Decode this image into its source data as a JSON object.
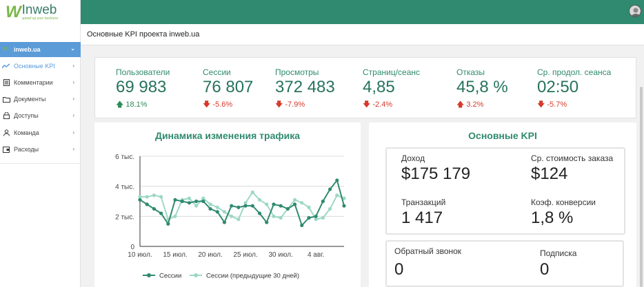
{
  "brand": {
    "logo_mark": "W",
    "name": "Inweb",
    "tagline": "speed up your business"
  },
  "sidebar": {
    "project": "inweb.ua",
    "items": [
      {
        "label": "Основные KPI",
        "icon": "trend-icon",
        "active": true
      },
      {
        "label": "Комментарии",
        "icon": "document-list-icon"
      },
      {
        "label": "Документы",
        "icon": "folder-icon"
      },
      {
        "label": "Доступы",
        "icon": "lock-icon"
      },
      {
        "label": "Команда",
        "icon": "user-icon"
      },
      {
        "label": "Расходы",
        "icon": "wallet-icon"
      }
    ]
  },
  "header": {
    "page_title": "Основные KPI проекта inweb.ua"
  },
  "kpis": [
    {
      "label": "Пользователи",
      "value": "69 983",
      "delta": "18.1%",
      "direction": "up",
      "color": "#2e8b57"
    },
    {
      "label": "Сессии",
      "value": "76 807",
      "delta": "-5.6%",
      "direction": "down",
      "color": "#d53a2b"
    },
    {
      "label": "Просмотры",
      "value": "372 483",
      "delta": "-7.9%",
      "direction": "down",
      "color": "#d53a2b"
    },
    {
      "label": "Страниц/сеанс",
      "value": "4,85",
      "delta": "-2.4%",
      "direction": "down",
      "color": "#d53a2b"
    },
    {
      "label": "Отказы",
      "value": "45,8 %",
      "delta": "3.2%",
      "direction": "up",
      "color": "#d53a2b"
    },
    {
      "label": "Ср. продол. сеанса",
      "value": "02:50",
      "delta": "-5.7%",
      "direction": "down",
      "color": "#d53a2b"
    }
  ],
  "traffic": {
    "title": "Динамика изменения трафика",
    "legend": [
      "Сессии",
      "Сессии (предыдущие 30 дней)"
    ]
  },
  "chart_data": {
    "type": "line",
    "title": "Динамика изменения трафика",
    "y_tick_labels": [
      "0",
      "2 тыс.",
      "4 тыс.",
      "6 тыс."
    ],
    "y_ticks": [
      0,
      2000,
      4000,
      6000
    ],
    "ylim": [
      0,
      6000
    ],
    "x_tick_labels": [
      "10 июл.",
      "15 июл.",
      "20 июл.",
      "25 июл.",
      "30 июл.",
      "4 авг."
    ],
    "x_tick_index": [
      0,
      5,
      10,
      15,
      20,
      25
    ],
    "grid": "horizontal",
    "legend_position": "bottom",
    "colors": [
      "#2f8a6f",
      "#9dd8c4"
    ],
    "series": [
      {
        "name": "Сессии",
        "values": [
          3100,
          2800,
          2500,
          2200,
          1500,
          3100,
          3000,
          2900,
          3000,
          3000,
          2500,
          2300,
          1600,
          2700,
          2600,
          2700,
          2700,
          2200,
          1600,
          2800,
          2700,
          2500,
          2800,
          1400,
          1900,
          2000,
          3000,
          3800,
          4400,
          2700
        ]
      },
      {
        "name": "Сессии (предыдущие 30 дней)",
        "values": [
          3300,
          3300,
          3400,
          3300,
          1800,
          2000,
          3100,
          3200,
          2700,
          3200,
          2800,
          2600,
          2300,
          2000,
          1800,
          2900,
          3600,
          3100,
          2800,
          2000,
          1900,
          2500,
          3100,
          2900,
          2600,
          1800,
          1900,
          2500,
          3400,
          3200
        ]
      }
    ]
  },
  "kpi_panel": {
    "title": "Основные KPI",
    "revenue_label": "Доход",
    "revenue_value": "$175 179",
    "aov_label": "Ср. стоимость заказа",
    "aov_value": "$124",
    "transactions_label": "Транзакций",
    "transactions_value": "1 417",
    "conversion_label": "Коэф. конверсии",
    "conversion_value": "1,8 %",
    "callback_label": "Обратный звонок",
    "callback_value": "0",
    "subscription_label": "Подписка",
    "subscription_value": "0"
  }
}
